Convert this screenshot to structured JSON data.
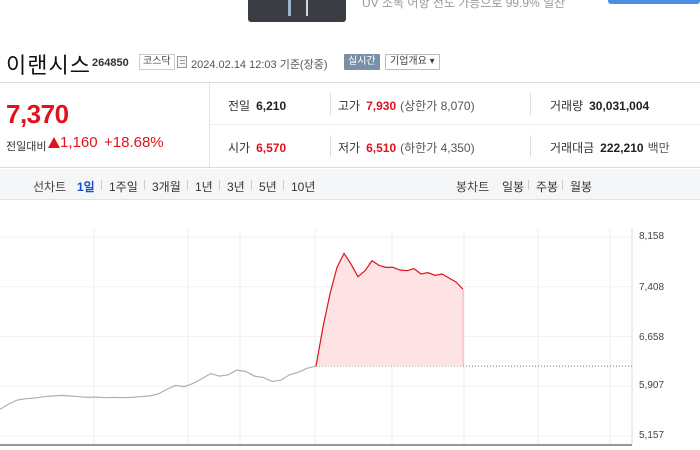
{
  "banner": {
    "text": "UV 소독 어항 전도 가능으로 99.9% 일산"
  },
  "header": {
    "name": "이랜시스",
    "code": "264850",
    "market": "코스닥",
    "date": "2024.02.14 12:03 기준(장중)",
    "realtime": "실시간",
    "company_info": "기업개요"
  },
  "price": {
    "current": "7,370",
    "change_label": "전일대비",
    "change": "1,160",
    "change_pct": "+18.68%",
    "direction": "up"
  },
  "stats": {
    "prev_label": "전일",
    "prev": "6,210",
    "high_label": "고가",
    "high": "7,930",
    "upper_limit": "(상한가 8,070)",
    "volume_label": "거래량",
    "volume": "30,031,004",
    "open_label": "시가",
    "open": "6,570",
    "low_label": "저가",
    "low": "6,510",
    "lower_limit": "(하한가 4,350)",
    "amount_label": "거래대금",
    "amount": "222,210",
    "amount_unit": "백만"
  },
  "tabs": {
    "line_title": "선차트",
    "line_tabs": [
      "1일",
      "1주일",
      "3개월",
      "1년",
      "3년",
      "5년",
      "10년"
    ],
    "active": "1일",
    "candle_title": "봉차트",
    "candle_tabs": [
      "일봉",
      "주봉",
      "월봉"
    ]
  },
  "colors": {
    "up": "#e0121b",
    "prev": "#b0b0b0",
    "fill": "#fde3e3"
  },
  "chart_data": {
    "type": "line",
    "y_ticks": [
      "8,158",
      "7,408",
      "6,658",
      "5,907",
      "5,157"
    ],
    "ylim": [
      5157,
      8158
    ],
    "prev_close": 6210,
    "series": [
      {
        "values": [
          5560,
          5640,
          5700,
          5720,
          5730,
          5750,
          5760,
          5770,
          5760,
          5750,
          5740,
          5745,
          5735,
          5740,
          5735,
          5740,
          5750,
          5760,
          5790,
          5860,
          5920,
          5900,
          5950,
          6020,
          6100,
          6060,
          6080,
          6150,
          6130,
          6060,
          6040,
          5980,
          6000,
          6080,
          6120,
          6180,
          6210
        ]
      },
      {
        "values": [
          6210,
          6800,
          7300,
          7700,
          7910,
          7750,
          7560,
          7650,
          7800,
          7730,
          7700,
          7700,
          7660,
          7650,
          7680,
          7600,
          7620,
          7580,
          7600,
          7540,
          7480,
          7370
        ]
      }
    ]
  }
}
